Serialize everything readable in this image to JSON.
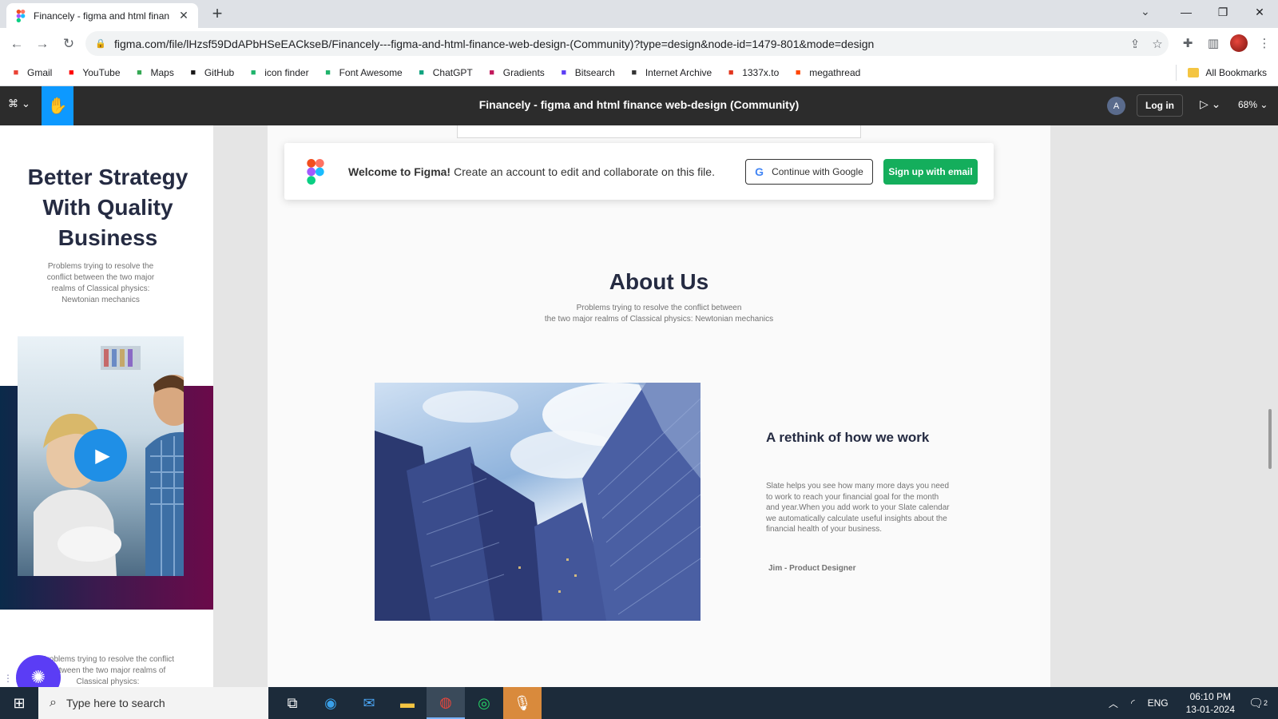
{
  "browser": {
    "tab_title": "Financely - figma and html finan",
    "url": "figma.com/file/lHzsf59DdAPbHSeEACkseB/Financely---figma-and-html-finance-web-design-(Community)?type=design&node-id=1479-801&mode=design",
    "bookmarks": [
      {
        "label": "Gmail",
        "icon": "gmail-icon",
        "color": "#ea4335"
      },
      {
        "label": "YouTube",
        "icon": "youtube-icon",
        "color": "#ff0000"
      },
      {
        "label": "Maps",
        "icon": "maps-icon",
        "color": "#34a853"
      },
      {
        "label": "GitHub",
        "icon": "github-icon",
        "color": "#181717"
      },
      {
        "label": "icon finder",
        "icon": "iconfinder-icon",
        "color": "#1fb36b"
      },
      {
        "label": "Font Awesome",
        "icon": "fontawesome-icon",
        "color": "#1fb36b"
      },
      {
        "label": "ChatGPT",
        "icon": "chatgpt-icon",
        "color": "#10a37f"
      },
      {
        "label": "Gradients",
        "icon": "gradients-icon",
        "color": "#c2185b"
      },
      {
        "label": "Bitsearch",
        "icon": "bitsearch-icon",
        "color": "#5b3df5"
      },
      {
        "label": "Internet Archive",
        "icon": "archive-icon",
        "color": "#333333"
      },
      {
        "label": "1337x.to",
        "icon": "x-icon",
        "color": "#e2351d"
      },
      {
        "label": "megathread",
        "icon": "reddit-icon",
        "color": "#ff4500"
      }
    ],
    "all_bookmarks": "All Bookmarks"
  },
  "figma": {
    "file_title": "Financely - figma and html finance web-design (Community)",
    "avatar_initial": "A",
    "login_label": "Log in",
    "zoom": "68%"
  },
  "welcome": {
    "bold": "Welcome to Figma!",
    "body": "Create an account to edit and collaborate on this file.",
    "google_button": "Continue with Google",
    "email_button": "Sign up with email"
  },
  "design": {
    "left_heading": "Better Strategy With Quality Business",
    "left_text": "Problems trying to resolve the conflict between the two major realms of Classical physics: Newtonian mechanics",
    "left_bottom_text": "Problems trying to resolve the conflict between the two major realms of Classical physics:",
    "about_title": "About Us",
    "about_sub_line1": "Problems trying to resolve the conflict between",
    "about_sub_line2": "the two major realms of Classical physics: Newtonian mechanics",
    "rethink_heading": "A rethink of how we work",
    "rethink_body": "Slate helps you see how many more days you need to work to reach your financial goal for the month and year.When you add work to your Slate calendar we automatically calculate useful insights about the financial health of your business.",
    "author": "Jim - Product Designer"
  },
  "taskbar": {
    "search_placeholder": "Type here to search",
    "language": "ENG",
    "time": "06:10 PM",
    "date": "13-01-2024",
    "notification_count": "2"
  }
}
